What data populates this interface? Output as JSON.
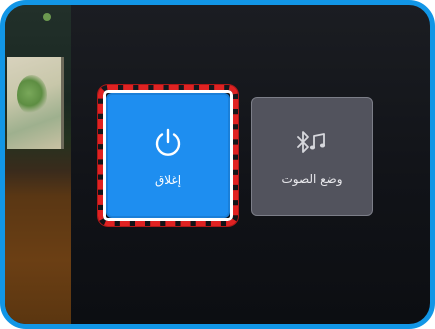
{
  "menu": {
    "tiles": [
      {
        "label": "إغلاق",
        "icon": "power-icon",
        "selected": true
      },
      {
        "label": "وضع الصوت",
        "icon": "bluetooth-music-icon",
        "selected": false
      }
    ]
  },
  "colors": {
    "frame_border": "#1296e6",
    "selected_tile": "#1e8ef0",
    "tile": "#52535d",
    "focus_ring": "#e02222"
  }
}
